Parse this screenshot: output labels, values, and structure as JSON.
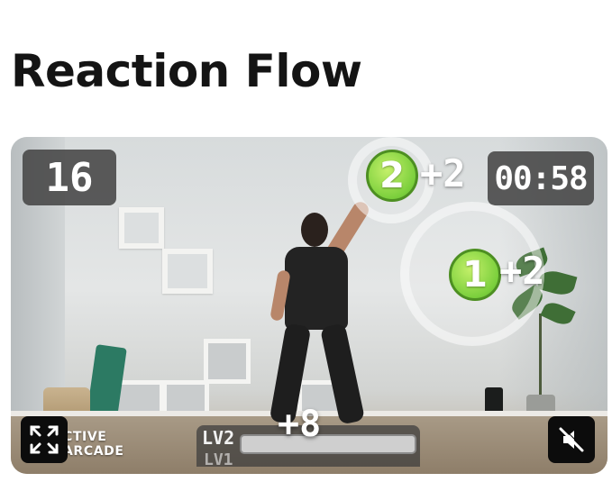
{
  "page": {
    "title": "Reaction Flow"
  },
  "game": {
    "score": "16",
    "timer": "00:58",
    "targets": [
      {
        "number": "2",
        "points": "+2",
        "color": "#7bcf3c"
      },
      {
        "number": "1",
        "points": "+2",
        "color": "#7bcf3c"
      }
    ],
    "bonus": "+8",
    "level_current": "LV2",
    "level_previous": "LV1",
    "level_progress": 0.0,
    "brand_line1": "CTIVE",
    "brand_line2": "ARCADE"
  },
  "controls": {
    "fullscreen_icon": "expand-icon",
    "mute_icon": "speaker-muted-icon"
  }
}
